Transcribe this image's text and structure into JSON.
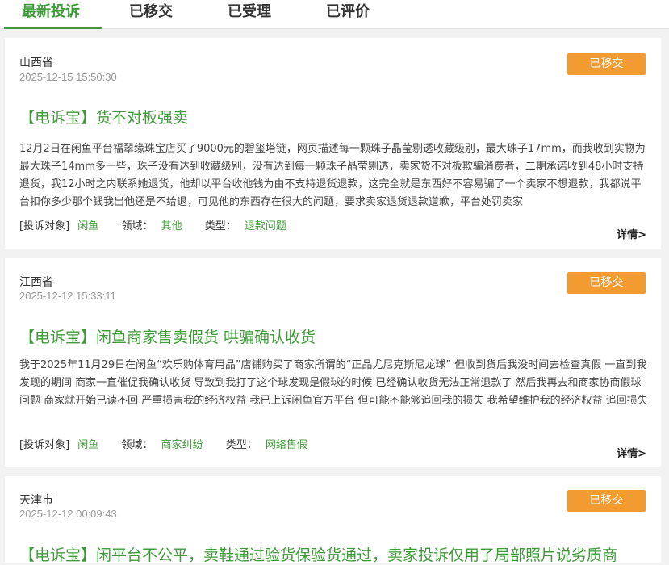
{
  "tabs": [
    {
      "label": "最新投诉"
    },
    {
      "label": "已移交"
    },
    {
      "label": "已受理"
    },
    {
      "label": "已评价"
    }
  ],
  "colors": {
    "accent": "#3f9b3a",
    "status": "#f29b31"
  },
  "complaints": [
    {
      "province": "山西省",
      "datetime": "2025-12-15 15:50:30",
      "status": "已移交",
      "title": "【电诉宝】货不对板强卖",
      "content": "12月2日在闲鱼平台福翠缘珠宝店买了9000元的碧玺塔链，网页描述每一颗珠子晶莹剔透收藏级别，最大珠子17mm，而我收到实物为最大珠子14mm多一些，珠子没有达到收藏级别，没有达到每一颗珠子晶莹剔透，卖家货不对板欺骗消费者，二期承诺收到48小时支持退货，我12小时之内联系她退货，他却以平台收他钱为由不支持退货退款，这完全就是东西好不容易骗了一个卖家不想退款，我都说平台扣你多少那个钱我出他还是不给退，可见他的东西存在很大的问题，要求卖家退货退款道歉，平台处罚卖家",
      "target_label": "[投诉对象]",
      "target": "闲鱼",
      "field_label": "领域：",
      "field": "其他",
      "type_label": "类型：",
      "type": "退款问题",
      "detail": "详情>"
    },
    {
      "province": "江西省",
      "datetime": "2025-12-12 15:33:11",
      "status": "已移交",
      "title": "【电诉宝】闲鱼商家售卖假货 哄骗确认收货",
      "content": "我于2025年11月29日在闲鱼“欢乐购体育用品”店铺购买了商家所谓的“正品尤尼克斯尼龙球” 但收到货后我没时间去检查真假 一直到我发现的期间 商家一直催促我确认收货 导致到我打了这个球发现是假球的时候 已经确认收货无法正常退款了 然后我再去和商家协商假球问题 商家就开始已读不回 严重损害我的经济权益 我已上诉闲鱼官方平台 但可能不能够追回我的损失 我希望维护我的经济权益 追回损失",
      "target_label": "[投诉对象]",
      "target": "闲鱼",
      "field_label": "领域：",
      "field": "商家纠纷",
      "type_label": "类型：",
      "type": "网络售假",
      "detail": "详情>"
    },
    {
      "province": "天津市",
      "datetime": "2025-12-12 00:09:43",
      "status": "已移交",
      "title": "【电诉宝】闲平台不公平，卖鞋通过验货保验货通过，卖家投诉仅用了局部照片说劣质商"
    }
  ]
}
